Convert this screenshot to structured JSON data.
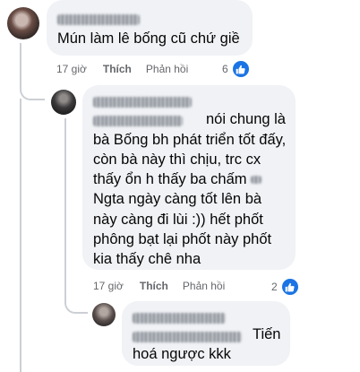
{
  "comments": [
    {
      "text": "Mún làm lê bống cũ chứ giề",
      "time": "17 giờ",
      "like_label": "Thích",
      "reply_label": "Phản hồi",
      "reaction_count": "6",
      "reaction_icon": "thumbs-up-icon"
    },
    {
      "lines": [
        "nói chung là",
        "bà Bống bh phát triển tốt đấy,",
        "còn bà này thì chịu, trc cx",
        "thấy ổn h thấy ba chấm",
        "Ngta ngày càng tốt lên bà",
        "này càng đi lùi :)) hết phốt",
        "phông bạt lại phốt này phốt",
        "kia thấy chê nha"
      ],
      "time": "17 giờ",
      "like_label": "Thích",
      "reply_label": "Phản hồi",
      "reaction_count": "2",
      "reaction_icon": "thumbs-up-icon"
    },
    {
      "lines": [
        "Tiến",
        "hoá ngược kkk"
      ]
    }
  ],
  "colors": {
    "bubble": "#f0f2f5",
    "secondary_text": "#65676b",
    "like_blue": "#1b74e4",
    "thread_line": "#ccd0d5"
  }
}
